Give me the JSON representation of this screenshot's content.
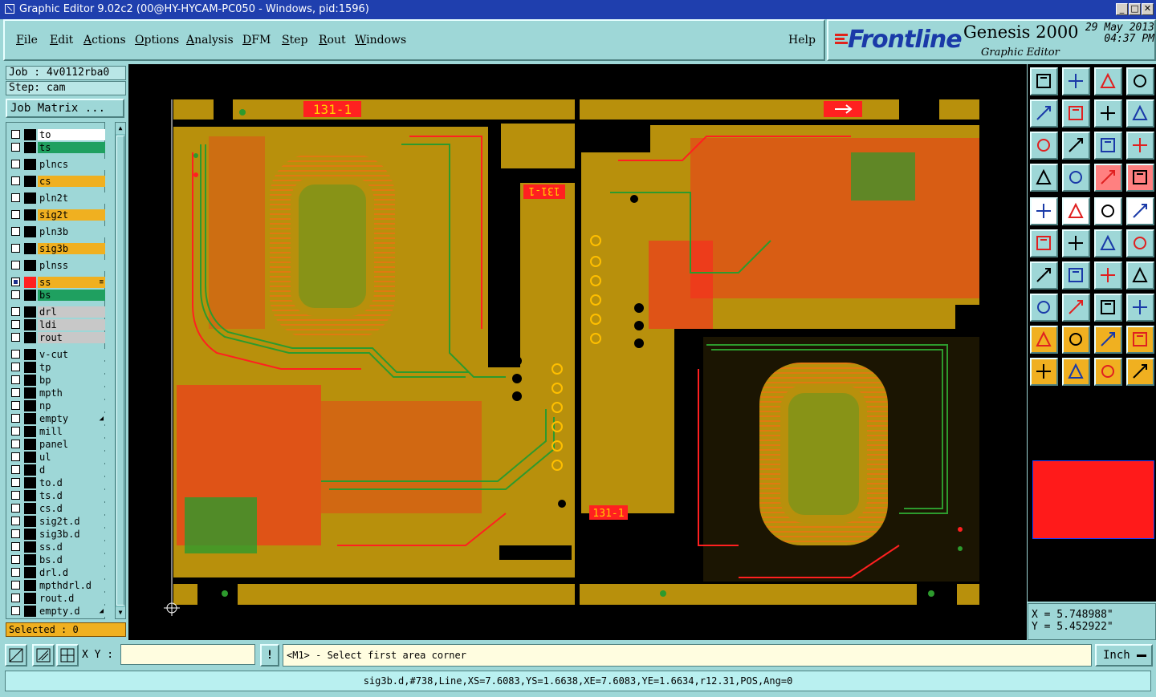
{
  "window": {
    "title": "Graphic Editor 9.02c2 (00@HY-HYCAM-PC050 - Windows, pid:1596)"
  },
  "menu": {
    "items": [
      {
        "label": "File",
        "u": "F",
        "rest": "ile"
      },
      {
        "label": "Edit",
        "u": "E",
        "rest": "dit"
      },
      {
        "label": "Actions",
        "u": "A",
        "rest": "ctions"
      },
      {
        "label": "Options",
        "u": "O",
        "rest": "ptions"
      },
      {
        "label": "Analysis",
        "u": "A",
        "rest": "nalysis"
      },
      {
        "label": "DFM",
        "u": "D",
        "rest": "FM"
      },
      {
        "label": "Step",
        "u": "S",
        "rest": "tep"
      },
      {
        "label": "Rout",
        "u": "R",
        "rest": "out"
      },
      {
        "label": "Windows",
        "u": "W",
        "rest": "indows"
      }
    ],
    "help": "Help"
  },
  "brand": {
    "logo": "Frontline",
    "product": "Genesis 2000",
    "subtitle": "Graphic Editor",
    "date": "29 May 2013",
    "time": "04:37 PM"
  },
  "job": {
    "job_label": "Job : 4v0112rba0",
    "step_label": "Step: cam",
    "matrix_button": "Job Matrix ..."
  },
  "layers": [
    {
      "name": "to",
      "color": "#ffffff",
      "swatch": "#000000"
    },
    {
      "name": "ts",
      "color": "#1fa060",
      "swatch": "#000000"
    },
    {
      "name": "plncs",
      "color": "#9ed7d7",
      "swatch": "#000000"
    },
    {
      "name": "cs",
      "color": "#f0b020",
      "swatch": "#000000"
    },
    {
      "name": "pln2t",
      "color": "#9ed7d7",
      "swatch": "#000000"
    },
    {
      "name": "sig2t",
      "color": "#f0b020",
      "swatch": "#000000"
    },
    {
      "name": "pln3b",
      "color": "#9ed7d7",
      "swatch": "#000000"
    },
    {
      "name": "sig3b",
      "color": "#f0b020",
      "swatch": "#000000"
    },
    {
      "name": "plnss",
      "color": "#9ed7d7",
      "swatch": "#000000"
    },
    {
      "name": "ss",
      "color": "#f0b020",
      "swatch": "#ff2020",
      "active": true,
      "mark": "≡"
    },
    {
      "name": "bs",
      "color": "#1fa060",
      "swatch": "#000000"
    },
    {
      "name": "drl",
      "color": "#c8c8c8",
      "swatch": "#000000"
    },
    {
      "name": "ldi",
      "color": "#c8c8c8",
      "swatch": "#000000"
    },
    {
      "name": "rout",
      "color": "#c8c8c8",
      "swatch": "#000000"
    },
    {
      "name": "v-cut",
      "color": "#9ed7d7",
      "swatch": "#000000"
    },
    {
      "name": "tp",
      "color": "#9ed7d7",
      "swatch": "#000000"
    },
    {
      "name": "bp",
      "color": "#9ed7d7",
      "swatch": "#000000"
    },
    {
      "name": "mpth",
      "color": "#9ed7d7",
      "swatch": "#000000"
    },
    {
      "name": "np",
      "color": "#9ed7d7",
      "swatch": "#000000"
    },
    {
      "name": "empty",
      "color": "#9ed7d7",
      "swatch": "#000000",
      "mark": "◢"
    },
    {
      "name": "mill",
      "color": "#9ed7d7",
      "swatch": "#000000"
    },
    {
      "name": "panel",
      "color": "#9ed7d7",
      "swatch": "#000000"
    },
    {
      "name": "ul",
      "color": "#9ed7d7",
      "swatch": "#000000"
    },
    {
      "name": "d",
      "color": "#9ed7d7",
      "swatch": "#000000"
    },
    {
      "name": "to.d",
      "color": "#9ed7d7",
      "swatch": "#000000"
    },
    {
      "name": "ts.d",
      "color": "#9ed7d7",
      "swatch": "#000000"
    },
    {
      "name": "cs.d",
      "color": "#9ed7d7",
      "swatch": "#000000"
    },
    {
      "name": "sig2t.d",
      "color": "#9ed7d7",
      "swatch": "#000000"
    },
    {
      "name": "sig3b.d",
      "color": "#9ed7d7",
      "swatch": "#000000"
    },
    {
      "name": "ss.d",
      "color": "#9ed7d7",
      "swatch": "#000000"
    },
    {
      "name": "bs.d",
      "color": "#9ed7d7",
      "swatch": "#000000"
    },
    {
      "name": "drl.d",
      "color": "#9ed7d7",
      "swatch": "#000000"
    },
    {
      "name": "mpthdrl.d",
      "color": "#9ed7d7",
      "swatch": "#000000"
    },
    {
      "name": "rout.d",
      "color": "#9ed7d7",
      "swatch": "#000000"
    },
    {
      "name": "empty.d",
      "color": "#9ed7d7",
      "swatch": "#000000",
      "mark": "◢"
    }
  ],
  "selected": "Selected : 0",
  "board": {
    "labels": [
      "131-1",
      "131-1",
      "131-1"
    ]
  },
  "coords": {
    "x": "X  = 5.748988\"",
    "y": "Y  = 5.452922\""
  },
  "cmd": {
    "xy_label": "X Y :",
    "xy_value": "",
    "prompt": "<M1> - Select first area corner",
    "units": "Inch",
    "excl": "!"
  },
  "status": "sig3b.d,#738,Line,XS=7.6083,YS=1.6638,XE=7.6083,YE=1.6634,r12.31,POS,Ang=0",
  "colors": {
    "copper": "#b8900c",
    "signal_red": "#ff2020",
    "signal_green": "#2d9a2d",
    "panel": "#9ed7d7"
  }
}
